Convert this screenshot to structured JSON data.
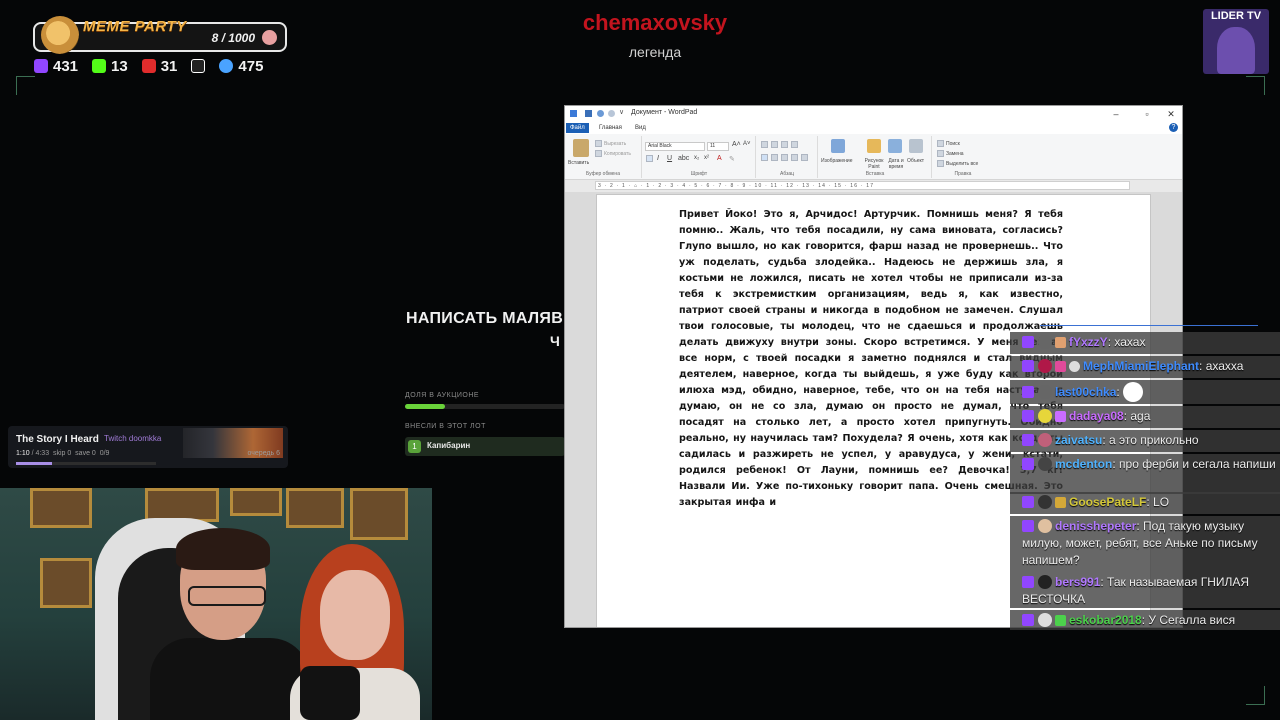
{
  "overlay": {
    "meme_party": {
      "title": "MEME PARTY",
      "count": "8 / 1000"
    },
    "stats": [
      {
        "icon": "twitch-icon",
        "value": "431",
        "color": "#9146ff"
      },
      {
        "icon": "kick-icon",
        "value": "13",
        "color": "#53fc18"
      },
      {
        "icon": "live-icon",
        "value": "31",
        "color": "#e12c2c"
      },
      {
        "icon": "w-icon",
        "value": "",
        "color": "#ffffff"
      },
      {
        "icon": "viewers-icon",
        "value": "475",
        "color": "#4aa3ff"
      }
    ],
    "streamer": {
      "name": "chemaxovsky",
      "status": "легенда"
    },
    "lider": {
      "label": "LIDER TV"
    }
  },
  "auction": {
    "title_line1": "НАПИСАТЬ МАЛЯВ",
    "title_line2": "Ч",
    "share_label": "ДОЛЯ В АУКЦИОНЕ",
    "share_fraction": 0.25,
    "lot_label": "ВНЕСЛИ В ЭТОТ ЛОТ",
    "lot_number": "1",
    "lot_user": "Капибарин"
  },
  "music": {
    "title": "The Story I Heard",
    "source": "Twitch doomkka",
    "time": "1:10",
    "duration": "/ 4:33",
    "skip": "skip 0",
    "save": "save 0",
    "votes": "0/9",
    "queue": "очередь 6",
    "progress_fraction": 0.26
  },
  "wordpad": {
    "window_title": "Документ - WordPad",
    "tabs": [
      "Файл",
      "Главная",
      "Вид"
    ],
    "clipboard": {
      "paste": "Вставить",
      "cut": "Вырезать",
      "copy": "Копировать",
      "label": "Буфер обмена"
    },
    "font": {
      "name": "Arial Black",
      "size": "11",
      "label": "Шрифт"
    },
    "paragraph_label": "Абзац",
    "insert": {
      "image": "Изображение",
      "paint": "Рисунок Paint",
      "datetime": "Дата и время",
      "object": "Объект",
      "label": "Вставка"
    },
    "editing": {
      "find": "Поиск",
      "replace": "Замена",
      "select_all": "Выделить все",
      "label": "Правка"
    },
    "ruler": "3 · 2 · 1 · ⌂ · 1 · 2 · 3 · 4 · 5 · 6 · 7 · 8 · 9 · 10 · 11 · 12 · 13 · 14 · 15 · 16 · 17",
    "document_text": "Привет Йоко! Это я, Арчидос! Артурчик. Помнишь меня? Я тебя помню.. Жаль, что тебя посадили, ну сама виновата, согласись? Глупо вышло, но как говорится, фарш назад не провернешь.. Что уж поделать, судьба злодейка.. Надеюсь не держишь зла, я костьми не ложился, писать не хотел чтобы не приписали из-за тебя к экстремистким организациям, ведь я, как известно, патриот своей страны и никогда в подобном не замечен. Слушал твои голосовые, ты молодец, что не сдаешься и продолжаешь делать движуху внутри зоны. Скоро встретимся. У меня сейчас все норм, с твоей посадки я заметно поднялся и стал видным деятелем, наверное, когда ты выйдешь, я уже буду как второй илюха мэд, обидно, наверное, тебе, что он на тебя настучал, я думаю, он не со зла, думаю он просто не думал, что тебя посадят на столько лет, а просто хотел припугнуть. Обидно реально, ну научилась там? Похудела? Я очень, хотя как когда ты садилась и разжиреть не успел, у аравудуса, у жени, кстати, родился ребенок! От Лауни, помнишь ее? Девочка! 3,7 кг! Назвали Ии. Уже по-тихоньку говорит папа. Очень смешная. Это закрытая инфа и"
  },
  "chat": [
    {
      "user": "fYxzzY",
      "text": "хахах",
      "color": "#b078ff"
    },
    {
      "user": "MephMiamiElephant",
      "text": "ахахха",
      "color": "#3f8cff"
    },
    {
      "user": "last00chka",
      "text": "",
      "color": "#3f8cff"
    },
    {
      "user": "dadaya08",
      "text": "aga",
      "color": "#c96cff"
    },
    {
      "user": "zaivatsu",
      "text": "а это прикольно",
      "color": "#4fb3ff"
    },
    {
      "user": "mcdenton",
      "text": "про ферби и сегала напиши",
      "color": "#4fb3ff"
    },
    {
      "user": "GoosePateLF",
      "text": "LO",
      "color": "#d4c838"
    },
    {
      "user": "denisshepeter",
      "text": "Под такую музыку милую, может, ребят, все Аньке по письму напишем?",
      "color": "#b078ff"
    },
    {
      "user": "bers991",
      "text": "Так называемая ГНИЛАЯ ВЕСТОЧКА",
      "color": "#b078ff"
    },
    {
      "user": "eskobar2018",
      "text": "У Сегалла вися",
      "color": "#4cd14c"
    }
  ]
}
